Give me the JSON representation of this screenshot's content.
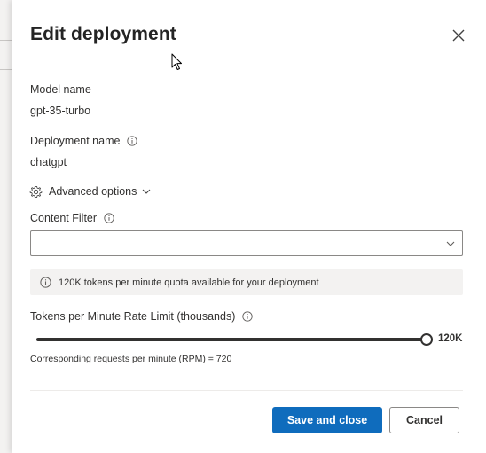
{
  "dialog": {
    "title": "Edit deployment"
  },
  "fields": {
    "model_name_label": "Model name",
    "model_name_value": "gpt-35-turbo",
    "deployment_name_label": "Deployment name",
    "deployment_name_value": "chatgpt",
    "advanced_options_label": "Advanced options",
    "content_filter_label": "Content Filter",
    "content_filter_value": ""
  },
  "quota": {
    "message": "120K tokens per minute quota available for your deployment"
  },
  "rate_limit": {
    "label": "Tokens per Minute Rate Limit (thousands)",
    "value_label": "120K",
    "level_fraction": 1.0,
    "rpm_text": "Corresponding requests per minute (RPM) = 720"
  },
  "actions": {
    "save_label": "Save and close",
    "cancel_label": "Cancel"
  },
  "icons": {
    "close": "close-icon",
    "info": "info-icon",
    "gear": "gear-icon",
    "chevron": "chevron-down-icon",
    "cursor": "mouse-cursor-icon"
  },
  "colors": {
    "primary": "#0f6cbd",
    "text": "#323130",
    "infobar_bg": "#f3f2f1"
  }
}
